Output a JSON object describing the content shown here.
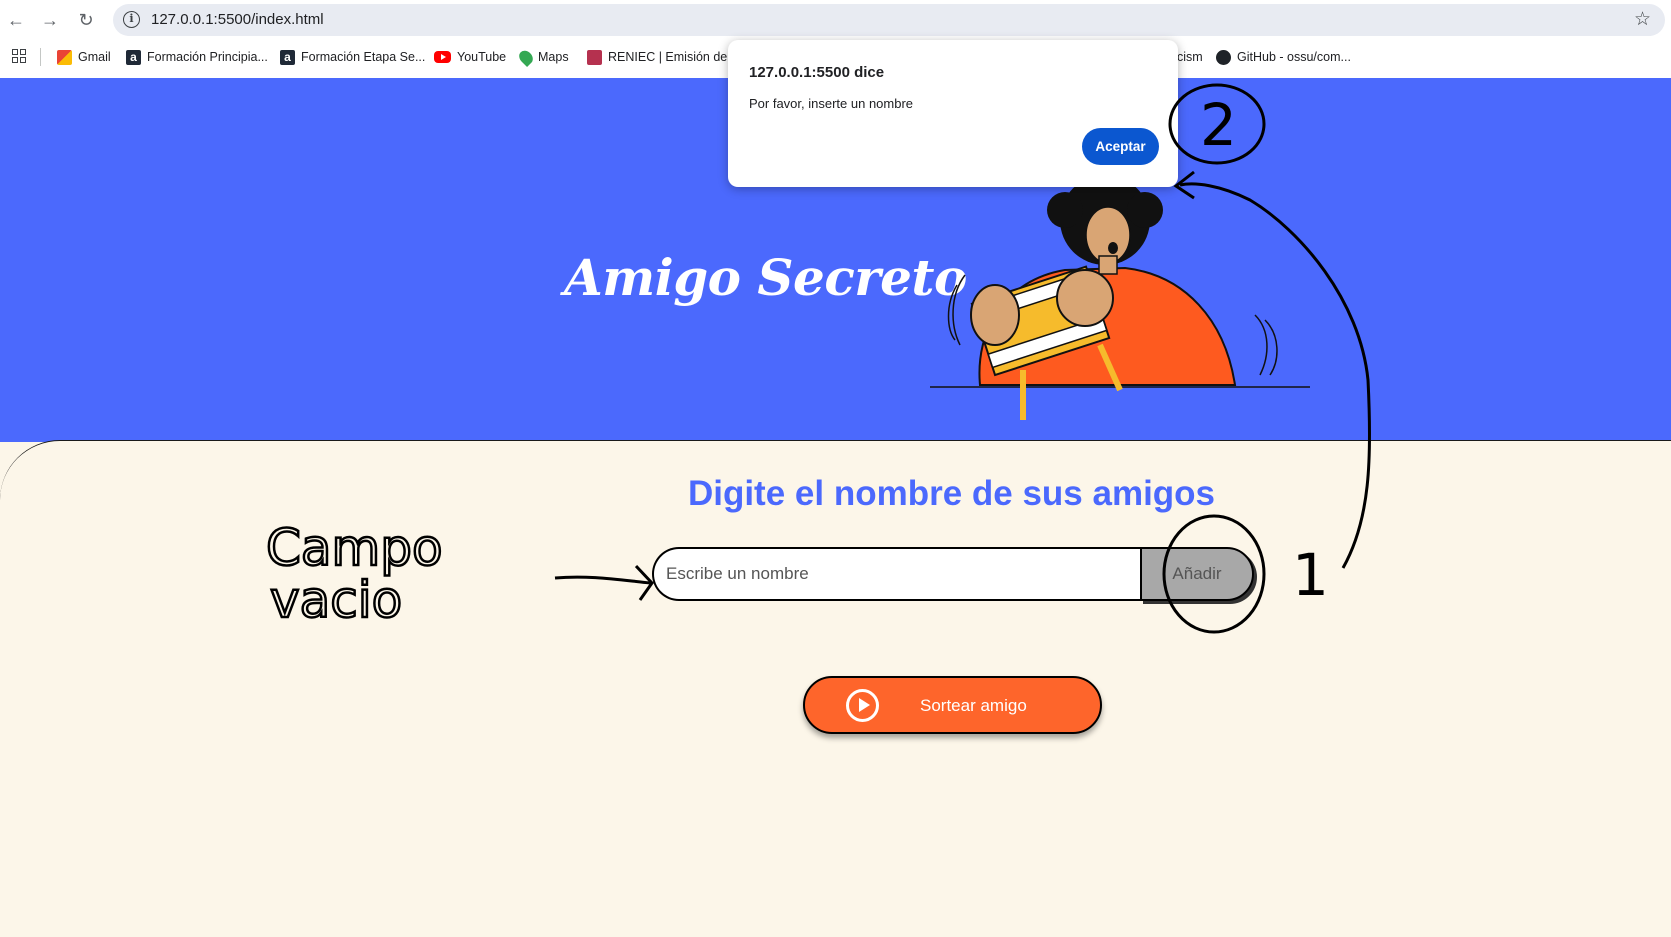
{
  "browser": {
    "url": "127.0.0.1:5500/index.html",
    "bookmarks": [
      "Gmail",
      "Formación Principia...",
      "Formación Etapa Se...",
      "YouTube",
      "Maps",
      "RENIEC | Emisión de...",
      "cism",
      "GitHub - ossu/com..."
    ]
  },
  "dialog": {
    "title": "127.0.0.1:5500 dice",
    "message": "Por favor, inserte un nombre",
    "ok_label": "Aceptar"
  },
  "page": {
    "title": "Amigo Secreto",
    "section_title": "Digite el nombre de sus amigos",
    "input_placeholder": "Escribe un nombre",
    "input_value": "",
    "add_label": "Añadir",
    "draw_label": "Sortear amigo"
  },
  "annotations": {
    "note_line1": "Campo",
    "note_line2": "vacio",
    "step1": "1",
    "step2": "2"
  },
  "colors": {
    "hero": "#4b69fd",
    "background": "#fcf6e9",
    "accent_orange": "#fe652b",
    "dialog_button": "#0b57d0"
  },
  "icons": [
    "back-arrow-icon",
    "forward-arrow-icon",
    "reload-icon",
    "site-info-icon",
    "bookmark-star-icon",
    "apps-grid-icon",
    "play-circle-icon"
  ]
}
